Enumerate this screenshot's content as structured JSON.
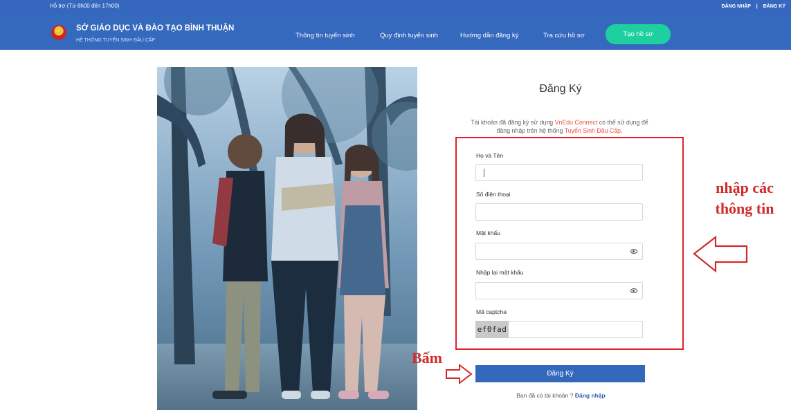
{
  "topbar": {
    "support": "Hỗ trợ (Từ 8h00 đến 17h00)",
    "login": "ĐĂNG NHẬP",
    "separator": "|",
    "register": "ĐĂNG KÝ"
  },
  "header": {
    "title": "SỞ GIÁO DỤC VÀ ĐÀO TẠO BÌNH THUẬN",
    "subtitle": "HỆ THỐNG TUYỂN SINH ĐẦU CẤP",
    "nav": [
      "Thông tin tuyển sinh",
      "Quy định tuyển sinh",
      "Hướng dẫn đăng ký",
      "Tra cứu hồ sơ"
    ],
    "cta": "Tạo hồ sơ"
  },
  "form": {
    "title": "Đăng Ký",
    "intro_pre": "Tài khoản đã đăng ký sử dụng ",
    "intro_link1": "VnEdu Connect",
    "intro_mid": " có thể sử dụng để đăng nhập trên hệ thống ",
    "intro_link2": "Tuyển Sinh Đầu Cấp",
    "intro_end": ".",
    "fields": {
      "fullname_label": "Họ và Tên",
      "phone_label": "Số điện thoại",
      "password_label": "Mật khẩu",
      "confirm_label": "Nhập lại mật khẩu",
      "captcha_label": "Mã captcha"
    },
    "captcha_code": "ef0fad",
    "submit": "Đăng Ký",
    "have_account": "Bạn đã có tài khoản ? ",
    "login_link": "Đăng nhập"
  },
  "annotations": {
    "fill_info_line1": "nhập các",
    "fill_info_line2": "thông tin",
    "press": "Bấm"
  },
  "colors": {
    "brand_blue": "#3469bd",
    "cta_green": "#1ecf9f",
    "annotation_red": "#d02a2a"
  }
}
